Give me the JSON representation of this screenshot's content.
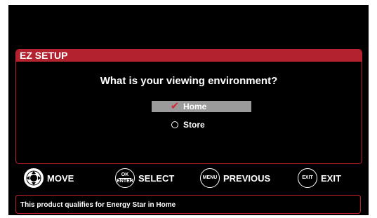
{
  "panel": {
    "title": "EZ SETUP",
    "question": "What is your viewing environment?",
    "options": [
      {
        "label": "Home",
        "selected": true
      },
      {
        "label": "Store",
        "selected": false
      }
    ]
  },
  "legend": {
    "move_label": "MOVE",
    "ok_label": "OK",
    "enter_label": "ENTER",
    "select_label": "SELECT",
    "menu_label": "MENU",
    "previous_label": "PREVIOUS",
    "exit_key_label": "EXIT",
    "exit_label": "EXIT"
  },
  "footer": {
    "message": "This product qualifies for Energy Star in Home"
  },
  "colors": {
    "accent": "#b3222f",
    "selection": "#9b9b9b"
  }
}
